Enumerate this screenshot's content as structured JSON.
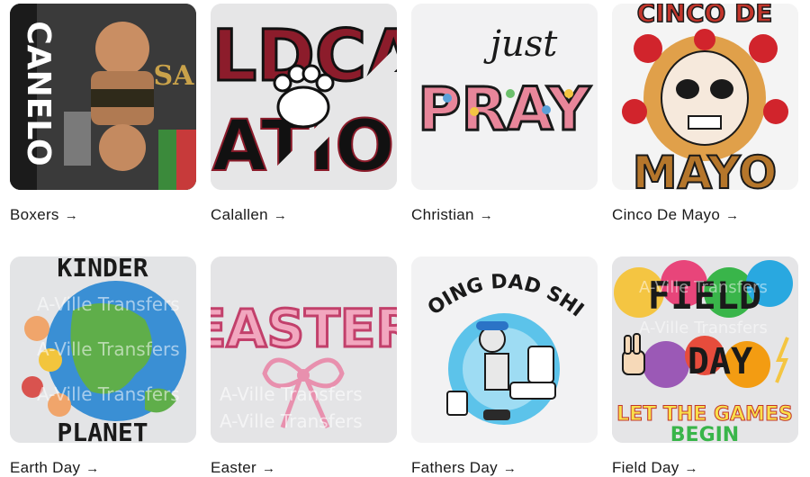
{
  "collections": [
    {
      "label": "Boxers",
      "arrow": "→"
    },
    {
      "label": "Calallen",
      "arrow": "→"
    },
    {
      "label": "Christian",
      "arrow": "→"
    },
    {
      "label": "Cinco De Mayo",
      "arrow": "→"
    },
    {
      "label": "Earth Day",
      "arrow": "→"
    },
    {
      "label": "Easter",
      "arrow": "→"
    },
    {
      "label": "Fathers Day",
      "arrow": "→"
    },
    {
      "label": "Field Day",
      "arrow": "→"
    }
  ],
  "artwork_text": {
    "boxers": "CANELO",
    "calallen_top": "ILDCA",
    "calallen_bottom": "ATIO",
    "christian_small": "just",
    "christian_big": "PRAY",
    "cinco_top": "CINCO DE",
    "cinco_bottom": "MAYO",
    "earth_top": "KINDER",
    "earth_bottom": "PLANET",
    "easter": "EASTER",
    "fathers": "DOING DAD SHIT",
    "field_top": "FIELD",
    "field_mid": "DAY",
    "field_bottom": "LET THE GAMES",
    "field_last": "BEGIN",
    "watermark": "A-Ville Transfers"
  },
  "colors": {
    "thumb_bg": "#e9e9ea",
    "text": "#1a1a1a",
    "maroon": "#8c1c2b",
    "pink": "#f2a7bf"
  }
}
